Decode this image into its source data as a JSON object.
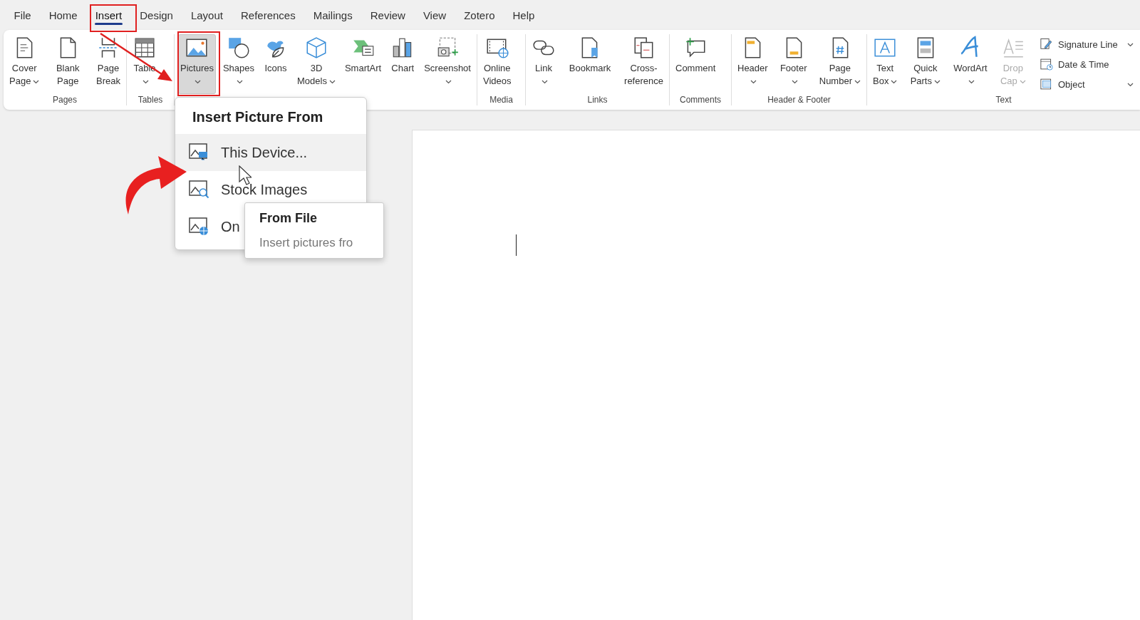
{
  "menu_tabs": [
    {
      "label": "File",
      "selected": false
    },
    {
      "label": "Home",
      "selected": false
    },
    {
      "label": "Insert",
      "selected": true
    },
    {
      "label": "Design",
      "selected": false
    },
    {
      "label": "Layout",
      "selected": false
    },
    {
      "label": "References",
      "selected": false
    },
    {
      "label": "Mailings",
      "selected": false
    },
    {
      "label": "Review",
      "selected": false
    },
    {
      "label": "View",
      "selected": false
    },
    {
      "label": "Zotero",
      "selected": false
    },
    {
      "label": "Help",
      "selected": false
    }
  ],
  "ribbon": {
    "groups": [
      {
        "label": "Pages",
        "buttons": [
          {
            "kind": "large",
            "lines": [
              "Cover",
              "Page"
            ],
            "dropdown": true,
            "pressed": false,
            "disabled": false
          },
          {
            "kind": "large",
            "lines": [
              "Blank",
              "Page"
            ],
            "dropdown": false,
            "pressed": false,
            "disabled": false
          },
          {
            "kind": "large",
            "lines": [
              "Page",
              "Break"
            ],
            "dropdown": false,
            "pressed": false,
            "disabled": false
          }
        ]
      },
      {
        "label": "Tables",
        "buttons": [
          {
            "kind": "large",
            "lines": [
              "Table"
            ],
            "dropdown": true,
            "pressed": false,
            "disabled": false
          }
        ]
      },
      {
        "buttons": [
          {
            "kind": "large",
            "lines": [
              "Pictures"
            ],
            "dropdown": true,
            "pressed": true,
            "disabled": false
          },
          {
            "kind": "large",
            "lines": [
              "Shapes"
            ],
            "dropdown": true,
            "pressed": false,
            "disabled": false
          },
          {
            "kind": "large",
            "lines": [
              "Icons"
            ],
            "dropdown": false,
            "pressed": false,
            "disabled": false
          },
          {
            "kind": "large",
            "lines": [
              "3D",
              "Models"
            ],
            "dropdown": true,
            "pressed": false,
            "disabled": false
          },
          {
            "kind": "large",
            "lines": [
              "SmartArt"
            ],
            "dropdown": false,
            "pressed": false,
            "disabled": false
          },
          {
            "kind": "large",
            "lines": [
              "Chart"
            ],
            "dropdown": false,
            "pressed": false,
            "disabled": false
          },
          {
            "kind": "large",
            "lines": [
              "Screenshot"
            ],
            "dropdown": true,
            "pressed": false,
            "disabled": false
          }
        ]
      },
      {
        "label": "Media",
        "buttons": [
          {
            "kind": "large",
            "lines": [
              "Online",
              "Videos"
            ],
            "dropdown": false,
            "pressed": false,
            "disabled": false
          }
        ]
      },
      {
        "label": "Links",
        "buttons": [
          {
            "kind": "large",
            "lines": [
              "Link"
            ],
            "dropdown": true,
            "pressed": false,
            "disabled": false
          },
          {
            "kind": "large",
            "lines": [
              "Bookmark"
            ],
            "dropdown": false,
            "pressed": false,
            "disabled": false
          },
          {
            "kind": "large",
            "lines": [
              "Cross-",
              "reference"
            ],
            "dropdown": false,
            "pressed": false,
            "disabled": false
          }
        ]
      },
      {
        "label": "Comments",
        "buttons": [
          {
            "kind": "large",
            "lines": [
              "Comment"
            ],
            "dropdown": false,
            "pressed": false,
            "disabled": false
          }
        ]
      },
      {
        "label": "Header & Footer",
        "buttons": [
          {
            "kind": "large",
            "lines": [
              "Header"
            ],
            "dropdown": true,
            "pressed": false,
            "disabled": false
          },
          {
            "kind": "large",
            "lines": [
              "Footer"
            ],
            "dropdown": true,
            "pressed": false,
            "disabled": false
          },
          {
            "kind": "large",
            "lines": [
              "Page",
              "Number"
            ],
            "dropdown": true,
            "pressed": false,
            "disabled": false
          }
        ]
      },
      {
        "label": "Text",
        "buttons": [
          {
            "kind": "large",
            "lines": [
              "Text",
              "Box"
            ],
            "dropdown": true,
            "pressed": false,
            "disabled": false
          },
          {
            "kind": "large",
            "lines": [
              "Quick",
              "Parts"
            ],
            "dropdown": true,
            "pressed": false,
            "disabled": false
          },
          {
            "kind": "large",
            "lines": [
              "WordArt"
            ],
            "dropdown": true,
            "pressed": false,
            "disabled": false
          },
          {
            "kind": "large",
            "lines": [
              "Drop",
              "Cap"
            ],
            "dropdown": true,
            "pressed": false,
            "disabled": true
          },
          {
            "kind": "small",
            "lines": [
              "Signature Line"
            ],
            "dropdown": true,
            "pressed": false,
            "disabled": false
          },
          {
            "kind": "small",
            "lines": [
              "Date & Time"
            ],
            "dropdown": false,
            "pressed": false,
            "disabled": false
          },
          {
            "kind": "small",
            "lines": [
              "Object"
            ],
            "dropdown": true,
            "pressed": false,
            "disabled": false
          }
        ]
      }
    ]
  },
  "picture_menu": {
    "title": "Insert Picture From",
    "items": [
      {
        "label": "This Device...",
        "hovered": true
      },
      {
        "label": "Stock Images",
        "hovered": false
      },
      {
        "label": "On",
        "hovered": false
      }
    ]
  },
  "tooltip": {
    "title": "From File",
    "text": "Insert pictures fro"
  }
}
